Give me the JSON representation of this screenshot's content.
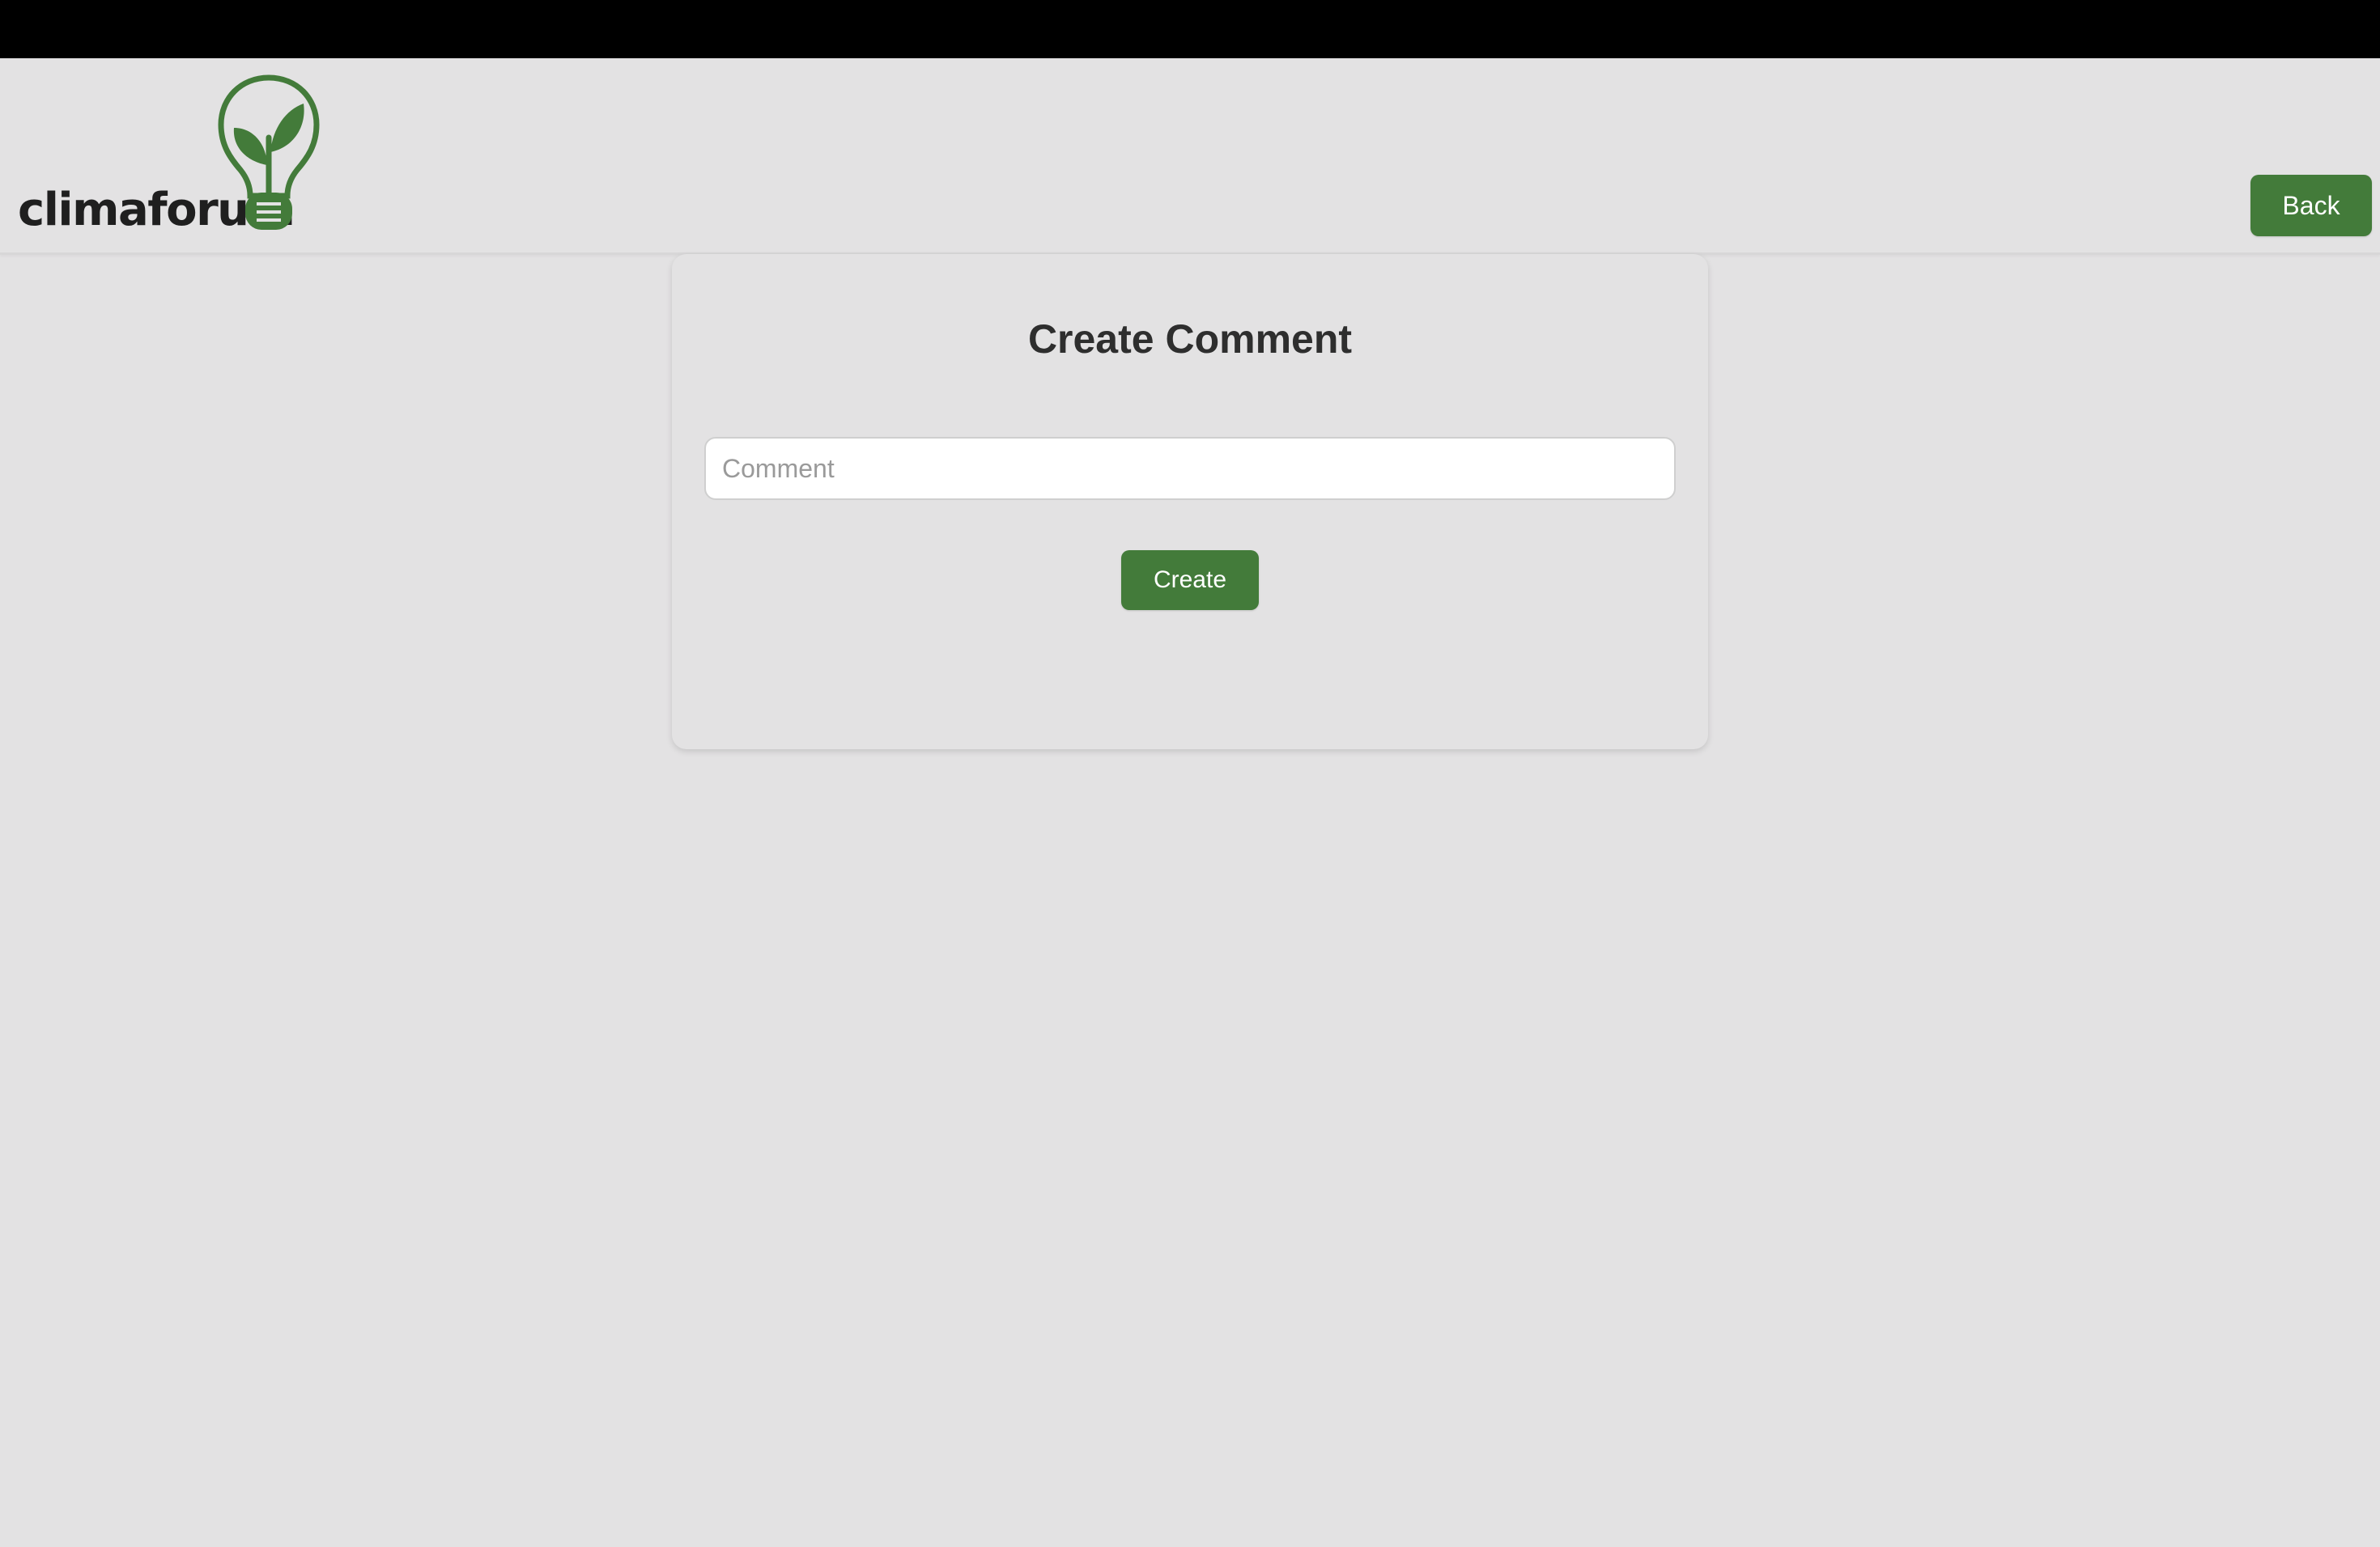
{
  "header": {
    "logo": {
      "text": "climaforum",
      "icon": "lightbulb-sprout-icon",
      "accent_color": "#437b3a"
    },
    "back_label": "Back"
  },
  "form": {
    "title": "Create Comment",
    "comment": {
      "value": "",
      "placeholder": "Comment"
    },
    "create_label": "Create"
  },
  "colors": {
    "background": "#e3e2e3",
    "button": "#437b3a",
    "button_text": "#ffffff",
    "top_strip": "#000000"
  }
}
